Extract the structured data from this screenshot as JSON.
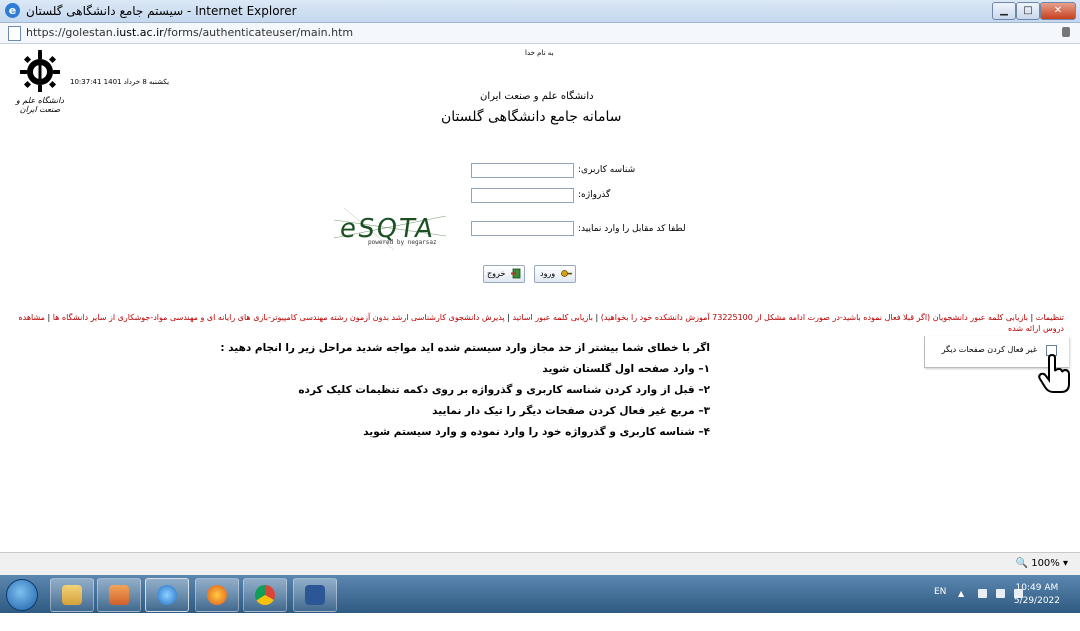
{
  "window": {
    "title": "سیستم جامع دانشگاهی گلستان - Internet Explorer",
    "minimize": "▁",
    "maximize": "□",
    "close": "✕"
  },
  "address": {
    "prefix": "https://golestan.",
    "domain": "iust.ac.ir",
    "path": "/forms/authenticateuser/main.htm"
  },
  "page": {
    "besmellah": "به نام خدا",
    "datetime": "10:37:41 یکشنبه 8 خرداد 1401",
    "logo_caption": "دانشگاه علم و صنعت ایران",
    "university": "دانشگاه علم و صنعت ایران",
    "system_title": "سامانه جامع دانشگاهی گلستان"
  },
  "form": {
    "username_label": "شناسه کاربری:",
    "password_label": "گذرواژه:",
    "captcha_label": "لطفا کد مقابل را وارد نمایید:",
    "captcha_text": "eSQTA",
    "captcha_powered": "powered by negarsaz",
    "login_button": "ورود",
    "exit_button": "خروج"
  },
  "links": [
    "تنظیمات",
    "بازیابی کلمه عبور دانشجویان (اگر قبلا فعال نموده باشید-در صورت ادامه مشکل از 73225100 آموزش دانشکده خود را بخواهید)",
    "بازیابی کلمه عبور اساتید",
    "پذیرش دانشجوی کارشناسی ارشد بدون آزمون رشته مهندسی کامپیوتر-بازی های رایانه ای و مهندسی مواد-جوشکاری از سایر دانشگاه ها",
    "مشاهده دروس ارائه شده"
  ],
  "sidebox": {
    "checkbox_label": "غیر فعال کردن صفحات دیگر"
  },
  "instructions": [
    "اگر با خطای شما بیشتر از حد مجاز وارد سیستم شده اید مواجه شدید مراحل زیر را انجام دهید :",
    "۱– وارد صفحه اول گلستان شوید",
    "۲– قبل از وارد کردن شناسه کاربری و گذرواژه بر روی دکمه تنظیمات کلیک کرده",
    "۳– مربع غیر فعال کردن صفحات دیگر را تیک دار نمایید",
    "۴– شناسه کاربری و گذرواژه خود را وارد نموده و وارد سیستم شوید"
  ],
  "status": {
    "zoom": "100%"
  },
  "taskbar": {
    "lang": "EN",
    "time": "10:49 AM",
    "date": "5/29/2022",
    "icons": [
      "file-explorer-icon",
      "media-player-icon",
      "internet-explorer-icon",
      "firefox-icon",
      "chrome-icon",
      "word-icon"
    ]
  }
}
